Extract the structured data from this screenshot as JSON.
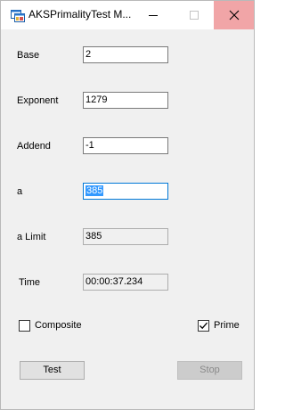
{
  "window": {
    "title": "AKSPrimalityTest M...",
    "colors": {
      "close_hover": "#f1a5a7",
      "selection": "#3399ff",
      "focus_border": "#0078d7"
    }
  },
  "fields": {
    "base": {
      "label": "Base",
      "value": "2"
    },
    "exponent": {
      "label": "Exponent",
      "value": "1279"
    },
    "addend": {
      "label": "Addend",
      "value": "-1"
    },
    "a": {
      "label": "a",
      "value": "385"
    },
    "a_limit": {
      "label": "a Limit",
      "value": "385"
    },
    "time": {
      "label": "Time",
      "value": "00:00:37.234"
    }
  },
  "checks": {
    "composite": {
      "label": "Composite",
      "checked": false
    },
    "prime": {
      "label": "Prime",
      "checked": true
    }
  },
  "buttons": {
    "test": "Test",
    "stop": "Stop"
  },
  "icons": [
    "app-icon",
    "minimize-icon",
    "maximize-icon",
    "close-icon",
    "checkmark-icon"
  ]
}
